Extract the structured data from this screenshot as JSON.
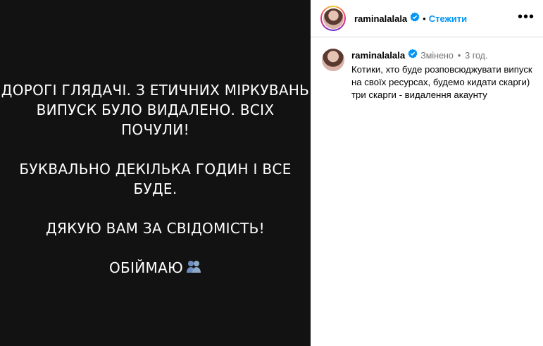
{
  "story": {
    "lines": [
      "ДОРОГІ ГЛЯДАЧІ. З ЕТИЧНИХ МІРКУВАНЬ",
      "ВИПУСК БУЛО ВИДАЛЕНО. ВСІХ ПОЧУЛИ!",
      "БУКВАЛЬНО ДЕКІЛЬКА ГОДИН І ВСЕ БУДЕ.",
      "ДЯКУЮ ВАМ ЗА СВІДОМІСТЬ!",
      "ОБІЙМАЮ"
    ],
    "emoji_icon": "people-hugging-icon"
  },
  "header": {
    "username": "raminalalala",
    "separator": "•",
    "follow_label": "Стежити",
    "more_label": "•••"
  },
  "comment": {
    "username": "raminalalala",
    "edited_label": "Змінено",
    "separator": "•",
    "time": "3 год.",
    "text": "Котики, хто буде розповсюджувати випуск на своїх ресурсах, будемо кидати скарги) три скарги - видалення акаунту"
  },
  "colors": {
    "background_media": "#121212",
    "accent": "#0095f6",
    "verified": "#0095f6",
    "muted": "#737373"
  }
}
